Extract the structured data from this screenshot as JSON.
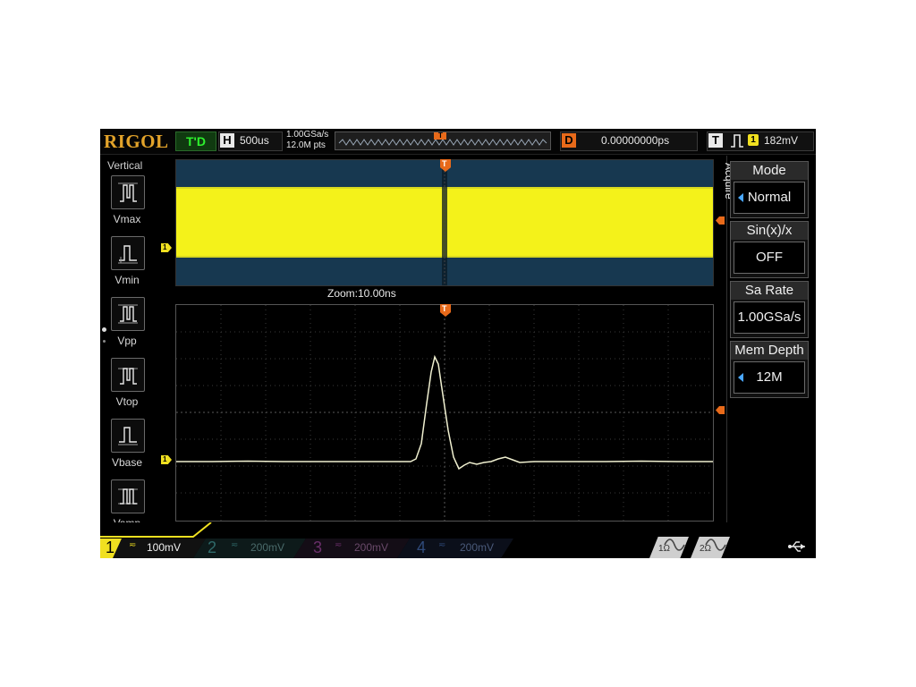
{
  "brand": "RIGOL",
  "run_status": "T'D",
  "timebase": {
    "tag": "H",
    "value": "500us"
  },
  "sample_rate_display": "1.00GSa/s",
  "mem_depth_display": "12.0M pts",
  "memory_bar": {
    "trigger_marker": "T"
  },
  "delay": {
    "tag": "D",
    "value": "0.00000000ps"
  },
  "trigger": {
    "tag": "T",
    "edge_icon": "rising-edge-icon",
    "source": "1",
    "level": "182mV"
  },
  "left_panel": {
    "title": "Vertical",
    "items": [
      {
        "label": "Vmax",
        "icon": "vmax-icon"
      },
      {
        "label": "Vmin",
        "icon": "vmin-icon"
      },
      {
        "label": "Vpp",
        "icon": "vpp-icon"
      },
      {
        "label": "Vtop",
        "icon": "vtop-icon"
      },
      {
        "label": "Vbase",
        "icon": "vbase-icon"
      },
      {
        "label": "Vamp",
        "icon": "vamp-icon"
      }
    ]
  },
  "zoom_label": "Zoom:10.00ns",
  "channel_marker": "1",
  "trigger_marker": "T",
  "right_menu": {
    "tab_label": "Acquire",
    "items": [
      {
        "title": "Mode",
        "value": "Normal",
        "has_arrow": true
      },
      {
        "title": "Sin(x)/x",
        "value": "OFF",
        "has_arrow": false
      },
      {
        "title": "Sa Rate",
        "value": "1.00GSa/s",
        "has_arrow": false
      },
      {
        "title": "Mem Depth",
        "value": "12M",
        "has_arrow": true
      }
    ]
  },
  "channels": [
    {
      "num": "1",
      "coupling": "≂",
      "scale": "100mV",
      "color": "#f0e020",
      "active": true
    },
    {
      "num": "2",
      "coupling": "≂",
      "scale": "200mV",
      "color": "#3ad0d0",
      "active": false
    },
    {
      "num": "3",
      "coupling": "≂",
      "scale": "200mV",
      "color": "#d040d0",
      "active": false
    },
    {
      "num": "4",
      "coupling": "≂",
      "scale": "200mV",
      "color": "#3a7aff",
      "active": false
    }
  ],
  "impedance": [
    {
      "label": "1Ω"
    },
    {
      "label": "2Ω"
    }
  ],
  "colors": {
    "ch1": "#f0e020",
    "trigger": "#e86a1a",
    "main_bg": "#173850"
  }
}
